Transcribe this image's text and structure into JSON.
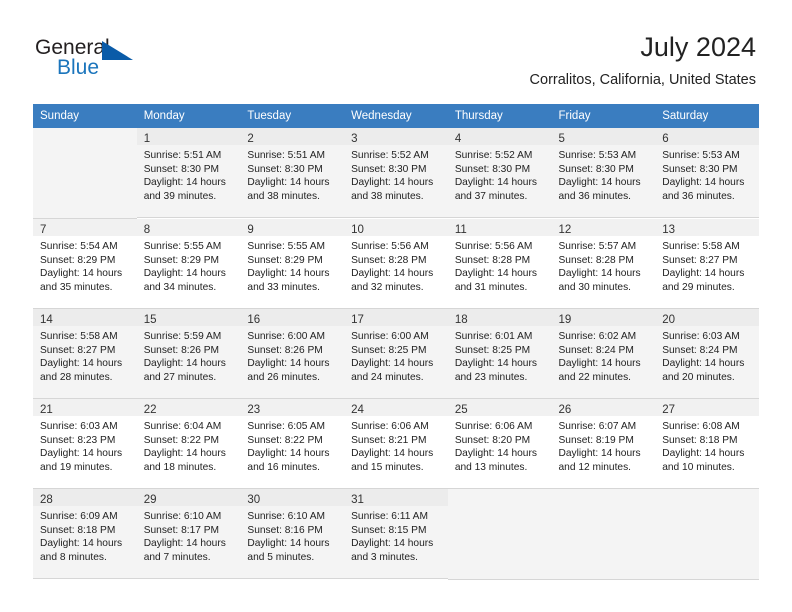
{
  "brand": {
    "word_one": "General",
    "word_two": "Blue",
    "triangle_icon": "triangle-icon",
    "accent_color": "#1b75bc"
  },
  "header": {
    "month_title": "July 2024",
    "location": "Corralitos, California, United States"
  },
  "theme": {
    "header_row_bg": "#3a7dc0",
    "header_row_text": "#ffffff",
    "row_alt_bg": "#f4f4f4",
    "daynum_bar_bg": "#f1f1f1",
    "cell_border": "#d6d6d6"
  },
  "calendar": {
    "weekday_headers": [
      "Sunday",
      "Monday",
      "Tuesday",
      "Wednesday",
      "Thursday",
      "Friday",
      "Saturday"
    ],
    "weeks": [
      [
        null,
        {
          "day": "1",
          "sunrise": "Sunrise: 5:51 AM",
          "sunset": "Sunset: 8:30 PM",
          "daylight_1": "Daylight: 14 hours",
          "daylight_2": "and 39 minutes."
        },
        {
          "day": "2",
          "sunrise": "Sunrise: 5:51 AM",
          "sunset": "Sunset: 8:30 PM",
          "daylight_1": "Daylight: 14 hours",
          "daylight_2": "and 38 minutes."
        },
        {
          "day": "3",
          "sunrise": "Sunrise: 5:52 AM",
          "sunset": "Sunset: 8:30 PM",
          "daylight_1": "Daylight: 14 hours",
          "daylight_2": "and 38 minutes."
        },
        {
          "day": "4",
          "sunrise": "Sunrise: 5:52 AM",
          "sunset": "Sunset: 8:30 PM",
          "daylight_1": "Daylight: 14 hours",
          "daylight_2": "and 37 minutes."
        },
        {
          "day": "5",
          "sunrise": "Sunrise: 5:53 AM",
          "sunset": "Sunset: 8:30 PM",
          "daylight_1": "Daylight: 14 hours",
          "daylight_2": "and 36 minutes."
        },
        {
          "day": "6",
          "sunrise": "Sunrise: 5:53 AM",
          "sunset": "Sunset: 8:30 PM",
          "daylight_1": "Daylight: 14 hours",
          "daylight_2": "and 36 minutes."
        }
      ],
      [
        {
          "day": "7",
          "sunrise": "Sunrise: 5:54 AM",
          "sunset": "Sunset: 8:29 PM",
          "daylight_1": "Daylight: 14 hours",
          "daylight_2": "and 35 minutes."
        },
        {
          "day": "8",
          "sunrise": "Sunrise: 5:55 AM",
          "sunset": "Sunset: 8:29 PM",
          "daylight_1": "Daylight: 14 hours",
          "daylight_2": "and 34 minutes."
        },
        {
          "day": "9",
          "sunrise": "Sunrise: 5:55 AM",
          "sunset": "Sunset: 8:29 PM",
          "daylight_1": "Daylight: 14 hours",
          "daylight_2": "and 33 minutes."
        },
        {
          "day": "10",
          "sunrise": "Sunrise: 5:56 AM",
          "sunset": "Sunset: 8:28 PM",
          "daylight_1": "Daylight: 14 hours",
          "daylight_2": "and 32 minutes."
        },
        {
          "day": "11",
          "sunrise": "Sunrise: 5:56 AM",
          "sunset": "Sunset: 8:28 PM",
          "daylight_1": "Daylight: 14 hours",
          "daylight_2": "and 31 minutes."
        },
        {
          "day": "12",
          "sunrise": "Sunrise: 5:57 AM",
          "sunset": "Sunset: 8:28 PM",
          "daylight_1": "Daylight: 14 hours",
          "daylight_2": "and 30 minutes."
        },
        {
          "day": "13",
          "sunrise": "Sunrise: 5:58 AM",
          "sunset": "Sunset: 8:27 PM",
          "daylight_1": "Daylight: 14 hours",
          "daylight_2": "and 29 minutes."
        }
      ],
      [
        {
          "day": "14",
          "sunrise": "Sunrise: 5:58 AM",
          "sunset": "Sunset: 8:27 PM",
          "daylight_1": "Daylight: 14 hours",
          "daylight_2": "and 28 minutes."
        },
        {
          "day": "15",
          "sunrise": "Sunrise: 5:59 AM",
          "sunset": "Sunset: 8:26 PM",
          "daylight_1": "Daylight: 14 hours",
          "daylight_2": "and 27 minutes."
        },
        {
          "day": "16",
          "sunrise": "Sunrise: 6:00 AM",
          "sunset": "Sunset: 8:26 PM",
          "daylight_1": "Daylight: 14 hours",
          "daylight_2": "and 26 minutes."
        },
        {
          "day": "17",
          "sunrise": "Sunrise: 6:00 AM",
          "sunset": "Sunset: 8:25 PM",
          "daylight_1": "Daylight: 14 hours",
          "daylight_2": "and 24 minutes."
        },
        {
          "day": "18",
          "sunrise": "Sunrise: 6:01 AM",
          "sunset": "Sunset: 8:25 PM",
          "daylight_1": "Daylight: 14 hours",
          "daylight_2": "and 23 minutes."
        },
        {
          "day": "19",
          "sunrise": "Sunrise: 6:02 AM",
          "sunset": "Sunset: 8:24 PM",
          "daylight_1": "Daylight: 14 hours",
          "daylight_2": "and 22 minutes."
        },
        {
          "day": "20",
          "sunrise": "Sunrise: 6:03 AM",
          "sunset": "Sunset: 8:24 PM",
          "daylight_1": "Daylight: 14 hours",
          "daylight_2": "and 20 minutes."
        }
      ],
      [
        {
          "day": "21",
          "sunrise": "Sunrise: 6:03 AM",
          "sunset": "Sunset: 8:23 PM",
          "daylight_1": "Daylight: 14 hours",
          "daylight_2": "and 19 minutes."
        },
        {
          "day": "22",
          "sunrise": "Sunrise: 6:04 AM",
          "sunset": "Sunset: 8:22 PM",
          "daylight_1": "Daylight: 14 hours",
          "daylight_2": "and 18 minutes."
        },
        {
          "day": "23",
          "sunrise": "Sunrise: 6:05 AM",
          "sunset": "Sunset: 8:22 PM",
          "daylight_1": "Daylight: 14 hours",
          "daylight_2": "and 16 minutes."
        },
        {
          "day": "24",
          "sunrise": "Sunrise: 6:06 AM",
          "sunset": "Sunset: 8:21 PM",
          "daylight_1": "Daylight: 14 hours",
          "daylight_2": "and 15 minutes."
        },
        {
          "day": "25",
          "sunrise": "Sunrise: 6:06 AM",
          "sunset": "Sunset: 8:20 PM",
          "daylight_1": "Daylight: 14 hours",
          "daylight_2": "and 13 minutes."
        },
        {
          "day": "26",
          "sunrise": "Sunrise: 6:07 AM",
          "sunset": "Sunset: 8:19 PM",
          "daylight_1": "Daylight: 14 hours",
          "daylight_2": "and 12 minutes."
        },
        {
          "day": "27",
          "sunrise": "Sunrise: 6:08 AM",
          "sunset": "Sunset: 8:18 PM",
          "daylight_1": "Daylight: 14 hours",
          "daylight_2": "and 10 minutes."
        }
      ],
      [
        {
          "day": "28",
          "sunrise": "Sunrise: 6:09 AM",
          "sunset": "Sunset: 8:18 PM",
          "daylight_1": "Daylight: 14 hours",
          "daylight_2": "and 8 minutes."
        },
        {
          "day": "29",
          "sunrise": "Sunrise: 6:10 AM",
          "sunset": "Sunset: 8:17 PM",
          "daylight_1": "Daylight: 14 hours",
          "daylight_2": "and 7 minutes."
        },
        {
          "day": "30",
          "sunrise": "Sunrise: 6:10 AM",
          "sunset": "Sunset: 8:16 PM",
          "daylight_1": "Daylight: 14 hours",
          "daylight_2": "and 5 minutes."
        },
        {
          "day": "31",
          "sunrise": "Sunrise: 6:11 AM",
          "sunset": "Sunset: 8:15 PM",
          "daylight_1": "Daylight: 14 hours",
          "daylight_2": "and 3 minutes."
        },
        null,
        null,
        null
      ]
    ]
  }
}
